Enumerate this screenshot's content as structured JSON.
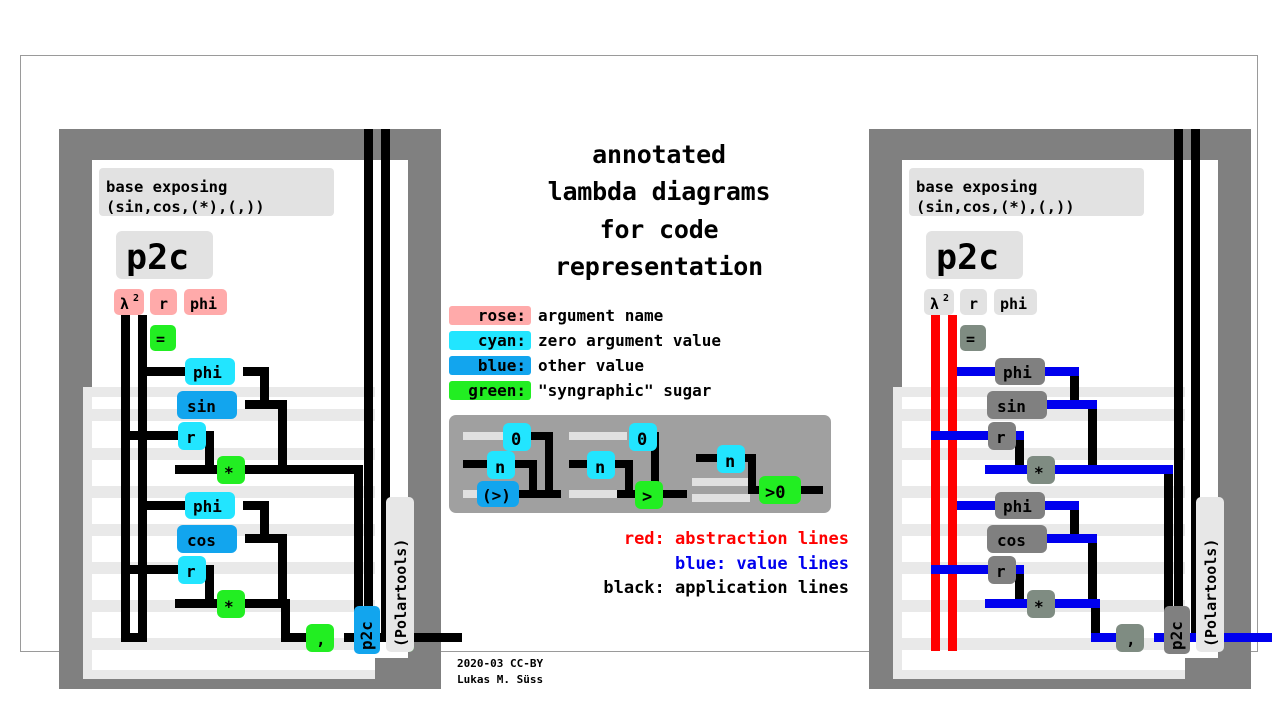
{
  "title_lines": [
    "annotated",
    "lambda diagrams",
    "for code",
    "representation"
  ],
  "legend": [
    {
      "key": "rose:",
      "value": "argument name",
      "color": "#ffaaaa"
    },
    {
      "key": "cyan:",
      "value": "zero argument value",
      "color": "#22e5ff"
    },
    {
      "key": "blue:",
      "value": "other value",
      "color": "#12a5ee"
    },
    {
      "key": "green:",
      "value": "\"syngraphic\" sugar",
      "color": "#22ee22"
    }
  ],
  "line_notes": [
    {
      "text": "red: abstraction lines",
      "color": "#ff0000"
    },
    {
      "text": "blue: value lines",
      "color": "#0000ee"
    },
    {
      "text": "black: application lines",
      "color": "#000000"
    }
  ],
  "credit": [
    "2020-03 CC-BY",
    "Lukas M. Süss"
  ],
  "examples": {
    "panel_color": "#a0a0a0",
    "groups": [
      {
        "nodes": [
          "0",
          "n",
          "(>)"
        ],
        "types": [
          "cyan",
          "cyan",
          "blue"
        ]
      },
      {
        "nodes": [
          "0",
          "n",
          ">"
        ],
        "types": [
          "cyan",
          "cyan",
          "green"
        ]
      },
      {
        "nodes": [
          "n",
          ">0"
        ],
        "types": [
          "cyan",
          "green"
        ]
      }
    ]
  },
  "diagram": {
    "header": [
      "base exposing",
      "(sin,cos,(*),(,))"
    ],
    "name": "p2c",
    "args": [
      "λ",
      "r",
      "phi"
    ],
    "lambda_superscript": "2",
    "eq": "=",
    "module": "(Polartools)",
    "nodes": [
      {
        "label": "phi",
        "type": "cyan"
      },
      {
        "label": "sin",
        "type": "blue"
      },
      {
        "label": "r",
        "type": "cyan"
      },
      {
        "label": "*",
        "type": "green"
      },
      {
        "label": "phi",
        "type": "cyan"
      },
      {
        "label": "cos",
        "type": "blue"
      },
      {
        "label": "r",
        "type": "cyan"
      },
      {
        "label": "*",
        "type": "green"
      },
      {
        "label": ",",
        "type": "green"
      },
      {
        "label": "p2c",
        "type": "blue"
      },
      {
        "label": "◁",
        "type": "green"
      }
    ]
  },
  "colors": {
    "rose": "#ffaaaa",
    "cyan": "#22e5ff",
    "blue": "#12a5ee",
    "green": "#22ee22",
    "gray_node": "#808080",
    "gray_frame": "#808080",
    "stripe": "#e0e0e0",
    "red_line": "#ff0000",
    "blue_line": "#0000ee",
    "black_line": "#000000"
  },
  "left_panel_mode": "colored",
  "right_panel_mode": "line-typed"
}
